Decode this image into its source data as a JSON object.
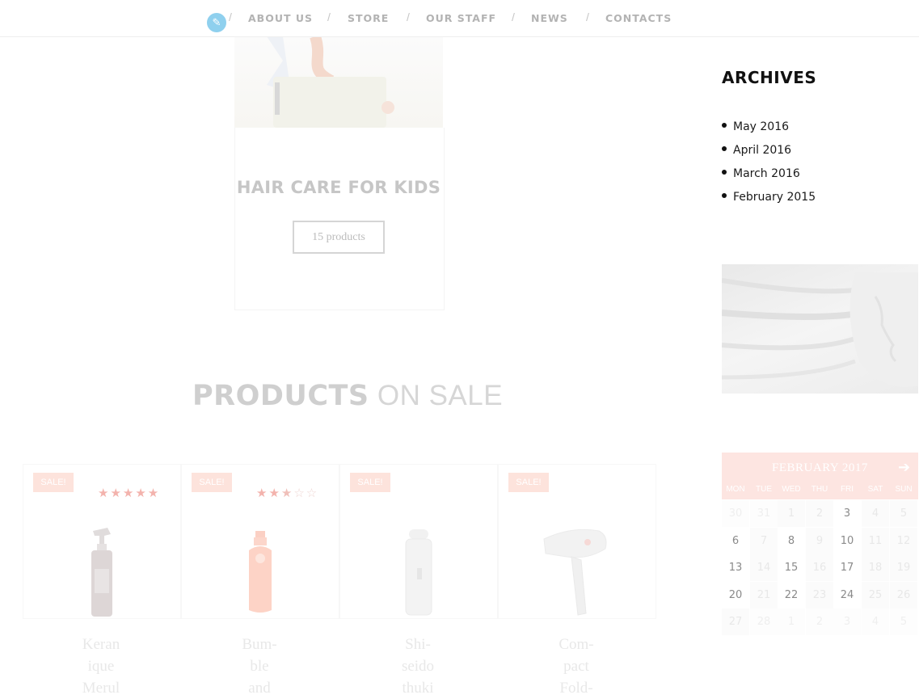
{
  "nav": {
    "items": [
      "ABOUT US",
      "STORE",
      "OUR STAFF",
      "NEWS",
      "CONTACTS"
    ],
    "separator": "/"
  },
  "featured": {
    "title": "HAIR CARE FOR KIDS",
    "button": "15 products"
  },
  "section": {
    "title_bold": "PRODUCTS",
    "title_light": "ON SALE"
  },
  "products": [
    {
      "badge": "SALE!",
      "rating": 5,
      "name_lines": [
        "Keran",
        "ique",
        "Merul"
      ]
    },
    {
      "badge": "SALE!",
      "rating": 2.5,
      "name_lines": [
        "Bum-",
        "ble",
        "and"
      ]
    },
    {
      "badge": "SALE!",
      "rating": null,
      "name_lines": [
        "Shi-",
        "seido",
        "thuki"
      ]
    },
    {
      "badge": "SALE!",
      "rating": null,
      "name_lines": [
        "Com-",
        "pact",
        "Fold-"
      ]
    }
  ],
  "sidebar": {
    "archives_title": "ARCHIVES",
    "archives": [
      "May 2016",
      "April 2016",
      "March 2016",
      "February 2015"
    ]
  },
  "calendar": {
    "month": "FEBRUARY 2017",
    "next_icon": "arrow-right-icon",
    "days": [
      "MON",
      "TUE",
      "WED",
      "THU",
      "FRI",
      "SAT",
      "SUN"
    ],
    "weeks": [
      [
        "30",
        "31",
        "1",
        "2",
        "3",
        "4",
        "5"
      ],
      [
        "6",
        "7",
        "8",
        "9",
        "10",
        "11",
        "12"
      ],
      [
        "13",
        "14",
        "15",
        "16",
        "17",
        "18",
        "19"
      ],
      [
        "20",
        "21",
        "22",
        "23",
        "24",
        "25",
        "26"
      ],
      [
        "27",
        "28",
        "1",
        "2",
        "3",
        "4",
        "5"
      ]
    ],
    "active_days": [
      "3",
      "6",
      "8",
      "10",
      "13",
      "15",
      "17",
      "20",
      "22",
      "24"
    ]
  },
  "colors": {
    "accent_pink": "#fde5e1",
    "edit_button": "#8fd0ee",
    "star": "#f3b3ad"
  }
}
